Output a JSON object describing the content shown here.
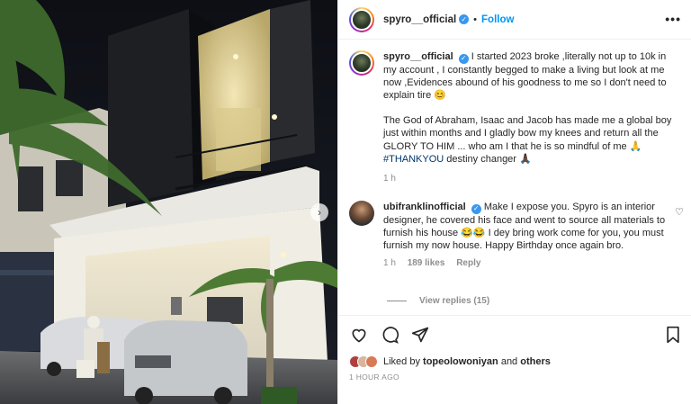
{
  "post": {
    "username": "spyro__official",
    "follow_label": "Follow",
    "separator": "•",
    "more_label": "•••"
  },
  "caption": {
    "username": "spyro__official",
    "text_1": "I started 2023 broke ,literally not up to 10k in my account , I constantly begged to make a living but look at me now ,Evidences abound of his goodness to me so I don't need to explain tire 😊",
    "text_2": "The God of Abraham, Isaac and Jacob has made me a global boy just within months and I gladly bow my knees and return all the GLORY TO HIM ... who am I that he is so mindful of me 🙏",
    "hashtag": "#THANKYOU",
    "text_3": " destiny changer 🙏🏿",
    "time": "1 h"
  },
  "comment": {
    "username": "ubifranklinofficial",
    "text": "Make I expose you. Spyro is an interior designer, he covered his face and went to source all materials to furnish his house 😂😂 I dey bring work come for you, you must furnish my now house. Happy Birthday once again bro.",
    "time": "1 h",
    "likes": "189 likes",
    "reply_label": "Reply",
    "view_replies": "View replies (15)"
  },
  "likes": {
    "prefix": "Liked by ",
    "user": "topeolowoniyan",
    "middle": " and ",
    "others": "others"
  },
  "post_time": "1 HOUR AGO",
  "icons": [
    "heart-icon",
    "comment-icon",
    "share-icon",
    "bookmark-icon",
    "chevron-right-icon",
    "more-icon",
    "verified-icon"
  ],
  "colors": {
    "accent": "#0095f6",
    "verified": "#3897f0",
    "secondary_text": "#8e8e8e"
  }
}
